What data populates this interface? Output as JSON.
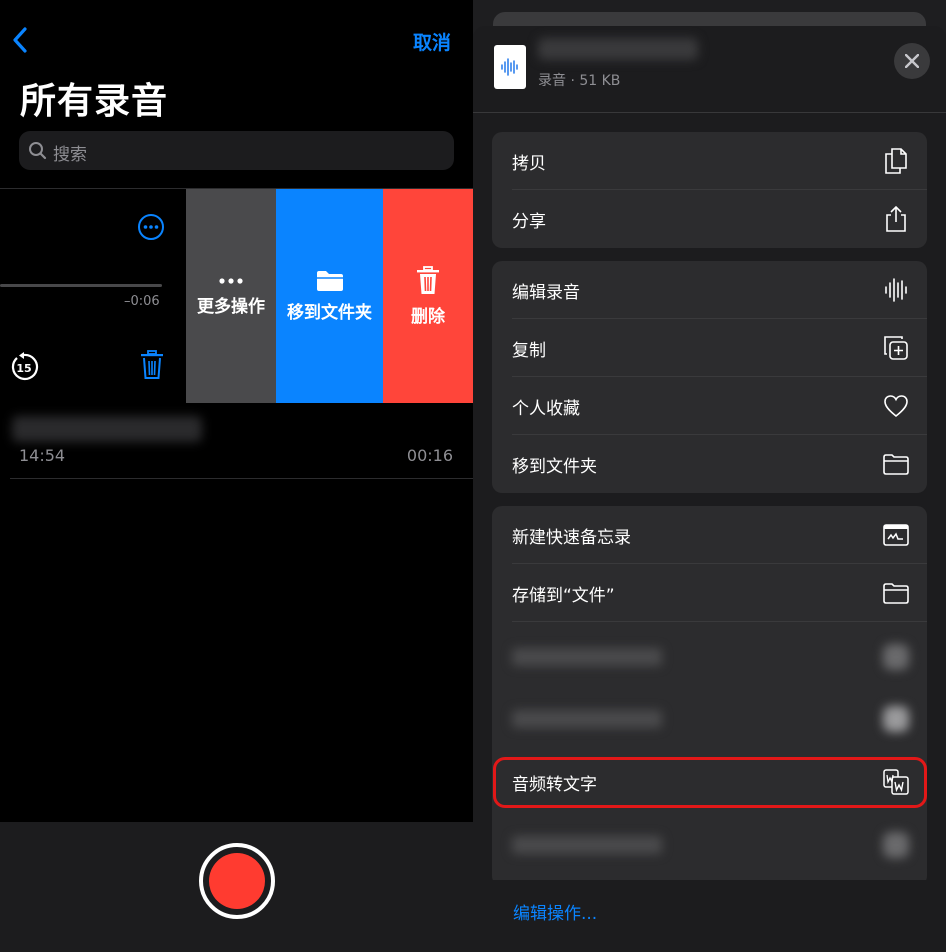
{
  "left": {
    "cancel_label": "取消",
    "title": "所有录音",
    "search_placeholder": "搜索",
    "remaining_time": "–0:06",
    "rewind_seconds": "15",
    "swipe_actions": {
      "more": "更多操作",
      "move": "移到文件夹",
      "delete": "删除"
    },
    "recording": {
      "date": "14:54",
      "duration": "00:16"
    }
  },
  "sheet": {
    "file_meta": "录音 · 51 KB",
    "groups": [
      {
        "items": [
          {
            "label": "拷贝",
            "icon": "copy-icon"
          },
          {
            "label": "分享",
            "icon": "share-icon"
          }
        ]
      },
      {
        "items": [
          {
            "label": "编辑录音",
            "icon": "waveform-icon"
          },
          {
            "label": "复制",
            "icon": "duplicate-icon"
          },
          {
            "label": "个人收藏",
            "icon": "heart-icon"
          },
          {
            "label": "移到文件夹",
            "icon": "folder-icon"
          }
        ]
      },
      {
        "items": [
          {
            "label": "新建快速备忘录",
            "icon": "quick-note-icon"
          },
          {
            "label": "存储到“文件”",
            "icon": "folder-icon"
          },
          {
            "label": "",
            "icon": ""
          },
          {
            "label": "",
            "icon": ""
          },
          {
            "label": "音频转文字",
            "icon": "transcribe-icon"
          },
          {
            "label": "",
            "icon": ""
          }
        ]
      }
    ],
    "edit_actions_label": "编辑操作..."
  },
  "colors": {
    "accent": "#0a84ff",
    "delete": "#ff453a",
    "record": "#ff3b30",
    "highlight": "#e21818"
  }
}
